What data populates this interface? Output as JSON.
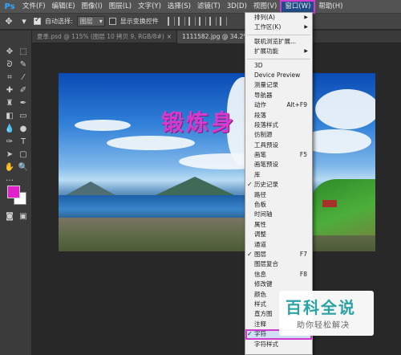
{
  "menubar": {
    "logo": "Ps",
    "items": [
      "文件(F)",
      "编辑(E)",
      "图像(I)",
      "图层(L)",
      "文字(Y)",
      "选择(S)",
      "滤镜(T)",
      "3D(D)",
      "视图(V)",
      "窗口(W)",
      "帮助(H)"
    ],
    "active_index": 9
  },
  "options": {
    "auto_select_label": "自动选择:",
    "auto_select_checked": true,
    "auto_select_value": "图层",
    "transform_label": "显示变换控件",
    "transform_checked": false
  },
  "tabs": [
    {
      "label": "夏季.psd @ 115% (图层 10 拷贝 9, RGB/8#)",
      "close": "×"
    },
    {
      "label": "1111582.jpg @ 34.2% (锻炼...",
      "close": "×"
    }
  ],
  "canvas": {
    "overlay_text": "锻炼身"
  },
  "colors": {
    "foreground": "#e020c8",
    "background": "#ffffff",
    "highlight_border": "#d23bd0"
  },
  "window_menu": {
    "group1": [
      {
        "label": "排列(A)",
        "submenu": true
      },
      {
        "label": "工作区(K)",
        "submenu": true
      }
    ],
    "group2": [
      {
        "label": "联机浏览扩展..."
      },
      {
        "label": "扩展功能",
        "submenu": true
      }
    ],
    "group3": [
      {
        "label": "3D"
      },
      {
        "label": "Device Preview"
      },
      {
        "label": "测量记录"
      },
      {
        "label": "导航器"
      },
      {
        "label": "动作",
        "shortcut": "Alt+F9"
      },
      {
        "label": "段落"
      },
      {
        "label": "段落样式"
      },
      {
        "label": "仿制源"
      },
      {
        "label": "工具预设"
      },
      {
        "label": "画笔",
        "shortcut": "F5"
      },
      {
        "label": "画笔预设"
      },
      {
        "label": "库"
      },
      {
        "label": "历史记录",
        "checked": true
      },
      {
        "label": "路径"
      },
      {
        "label": "色板"
      },
      {
        "label": "时间轴"
      },
      {
        "label": "属性"
      },
      {
        "label": "调整"
      },
      {
        "label": "通道"
      },
      {
        "label": "图层",
        "shortcut": "F7",
        "checked": true
      },
      {
        "label": "图层复合"
      },
      {
        "label": "信息",
        "shortcut": "F8"
      },
      {
        "label": "修改键"
      },
      {
        "label": "颜色"
      },
      {
        "label": "样式"
      },
      {
        "label": "直方图"
      },
      {
        "label": "注释"
      },
      {
        "label": "字符",
        "checked": true,
        "highlighted": true
      },
      {
        "label": "字符样式"
      }
    ]
  },
  "watermark": {
    "title": "百科全说",
    "subtitle": "助你轻松解决"
  }
}
